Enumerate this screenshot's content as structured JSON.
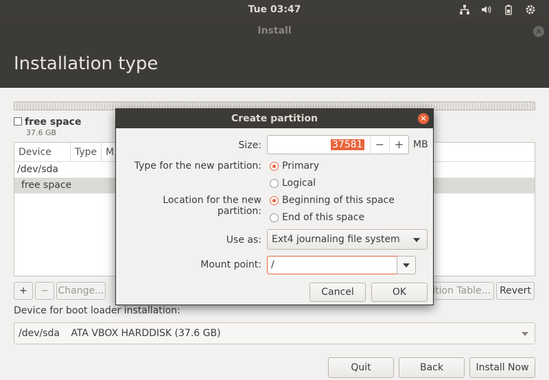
{
  "topbar": {
    "clock": "Tue 03:47"
  },
  "window": {
    "title": "Install",
    "close_glyph": "×"
  },
  "header": {
    "title": "Installation type"
  },
  "legend": {
    "name": "free space",
    "size": "37.6 GB"
  },
  "table": {
    "columns": [
      "Device",
      "Type",
      "M"
    ],
    "rows": [
      "/dev/sda",
      "free space"
    ]
  },
  "toolbar": {
    "add": "+",
    "remove": "−",
    "change": "Change...",
    "new_table": "ition Table...",
    "revert": "Revert"
  },
  "boot": {
    "label": "Device for boot loader installation:",
    "device": "/dev/sda",
    "description": "ATA VBOX HARDDISK (37.6 GB)"
  },
  "footer": {
    "quit": "Quit",
    "back": "Back",
    "install": "Install Now"
  },
  "dialog": {
    "title": "Create partition",
    "close_glyph": "×",
    "size_label": "Size:",
    "size_value": "37581",
    "size_unit": "MB",
    "minus": "−",
    "plus": "+",
    "type_label": "Type for the new partition:",
    "type_primary": "Primary",
    "type_logical": "Logical",
    "location_label": "Location for the new partition:",
    "location_beginning": "Beginning of this space",
    "location_end": "End of this space",
    "use_as_label": "Use as:",
    "use_as_value": "Ext4 journaling file system",
    "mount_label": "Mount point:",
    "mount_value": "/",
    "cancel": "Cancel",
    "ok": "OK"
  },
  "colors": {
    "accent": "#e8643c",
    "header_bg": "#3c3b37",
    "panel_bg": "#3e3d39",
    "window_bg": "#f2f1f0"
  },
  "icons": [
    "network-icon",
    "volume-icon",
    "battery-icon",
    "gear-icon"
  ]
}
